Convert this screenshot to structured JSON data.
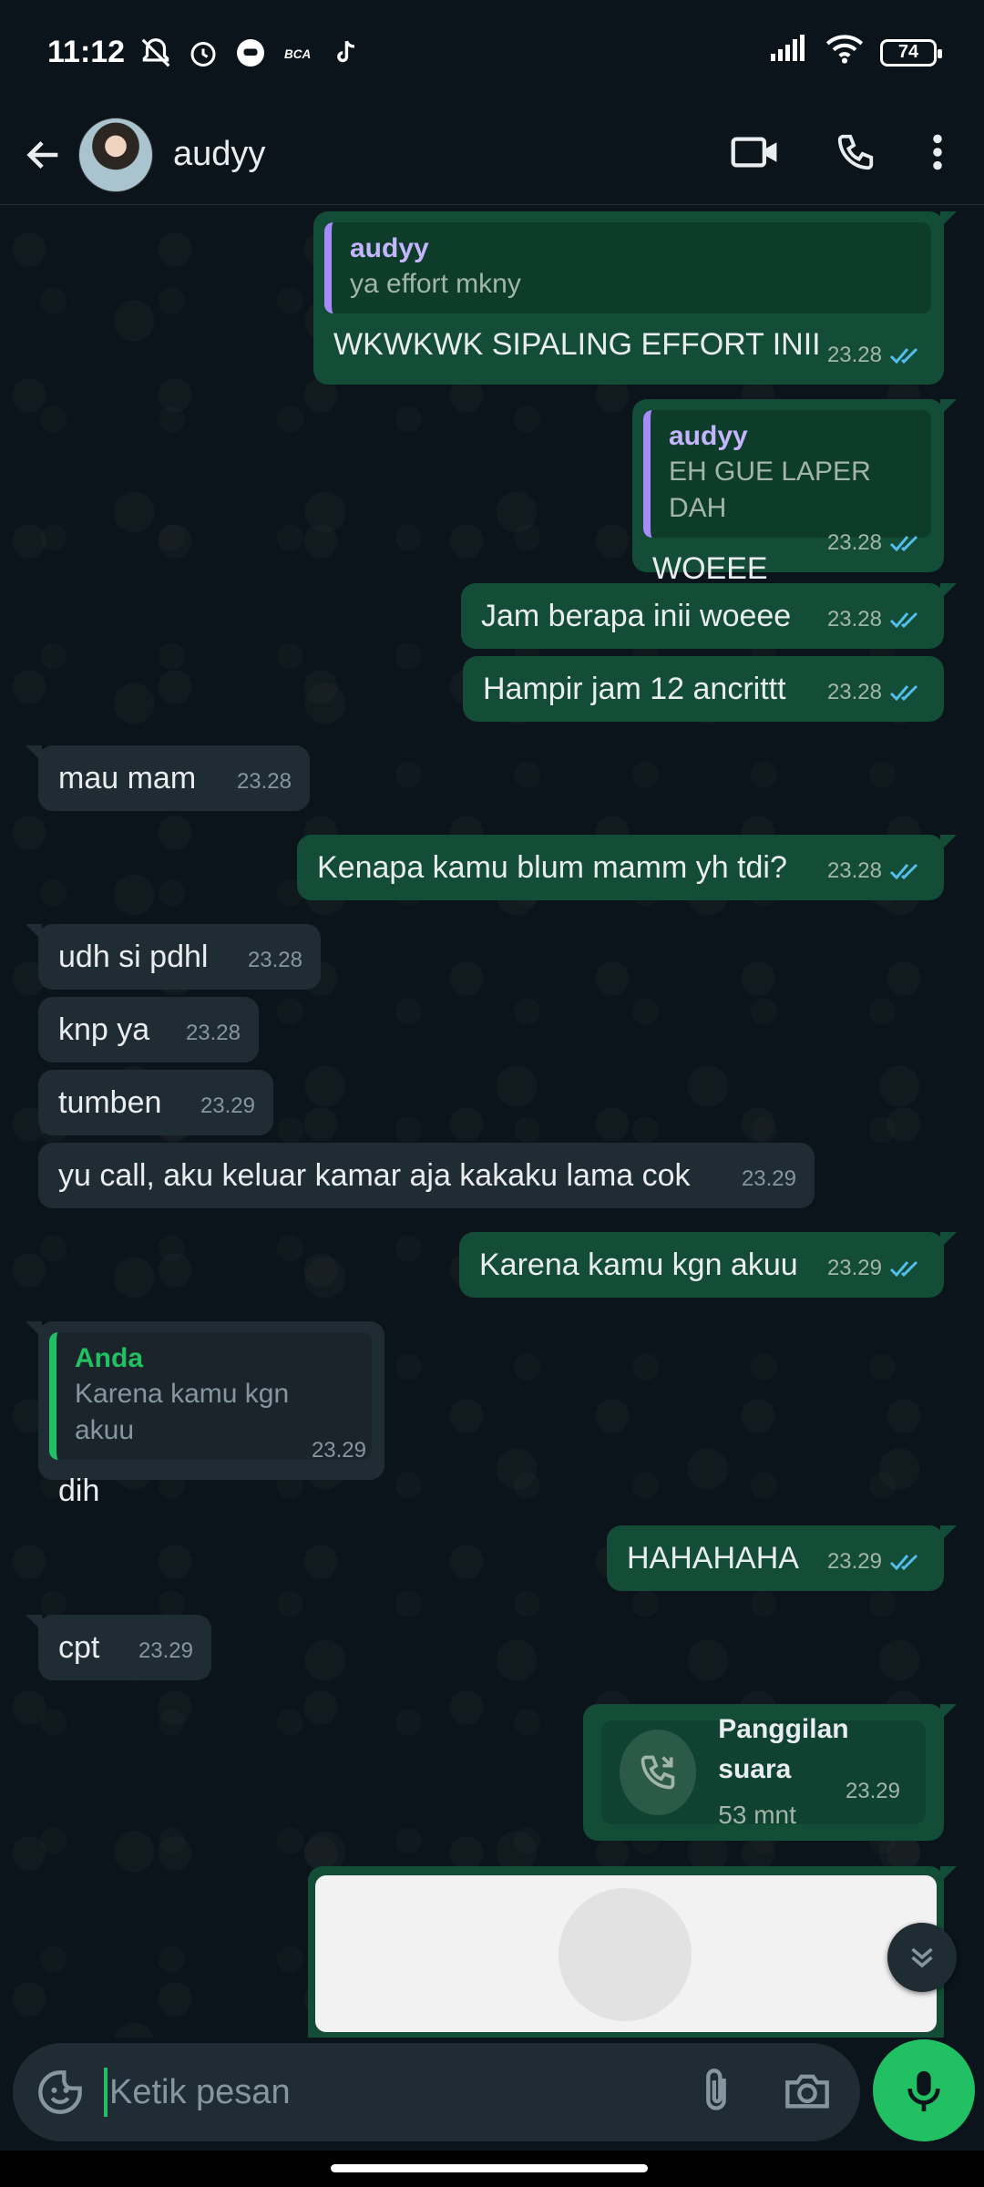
{
  "status_bar": {
    "time": "11:12",
    "battery": "74"
  },
  "header": {
    "contact_name": "audyy"
  },
  "messages": [
    {
      "dir": "out",
      "quote_name": "audyy",
      "quote_text": "ya effort mkny",
      "text": "WKWKWK SIPALING EFFORT INII",
      "time": "23.28"
    },
    {
      "dir": "out",
      "quote_name": "audyy",
      "quote_text": "EH GUE LAPER DAH",
      "text": "WOEEE",
      "time": "23.28"
    },
    {
      "dir": "out",
      "text": "Jam berapa inii woeee",
      "time": "23.28"
    },
    {
      "dir": "out",
      "text": "Hampir jam 12 ancrittt",
      "time": "23.28"
    },
    {
      "dir": "in",
      "text": "mau mam",
      "time": "23.28"
    },
    {
      "dir": "out",
      "text": "Kenapa kamu blum mamm yh tdi?",
      "time": "23.28"
    },
    {
      "dir": "in",
      "text": "udh si pdhl",
      "time": "23.28"
    },
    {
      "dir": "in",
      "text": "knp ya",
      "time": "23.28"
    },
    {
      "dir": "in",
      "text": "tumben",
      "time": "23.29"
    },
    {
      "dir": "in",
      "text": "yu call, aku keluar kamar aja kakaku lama cok",
      "time": "23.29"
    },
    {
      "dir": "out",
      "text": "Karena kamu kgn akuu",
      "time": "23.29"
    },
    {
      "dir": "in",
      "quote_name": "Anda",
      "quote_text": "Karena kamu kgn akuu",
      "text": "dih",
      "time": "23.29"
    },
    {
      "dir": "out",
      "text": "HAHAHAHA",
      "time": "23.29"
    },
    {
      "dir": "in",
      "text": "cpt",
      "time": "23.29"
    }
  ],
  "call": {
    "title": "Panggilan suara",
    "duration": "53 mnt",
    "time": "23.29"
  },
  "composer": {
    "placeholder": "Ketik pesan"
  },
  "colors": {
    "outgoing": "#134d37",
    "incoming": "#202c33",
    "accent": "#21c063",
    "read_ticks": "#53bdeb"
  }
}
